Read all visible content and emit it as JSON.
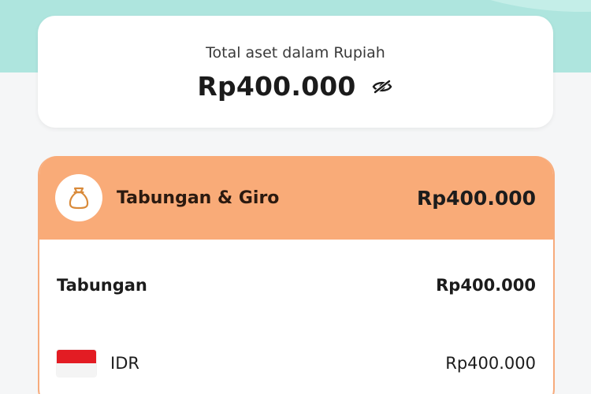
{
  "summary": {
    "label": "Total aset dalam Rupiah",
    "amount": "Rp400.000",
    "visibility_icon": "eye-slash-icon"
  },
  "group": {
    "icon": "money-bag-icon",
    "title": "Tabungan & Giro",
    "total": "Rp400.000"
  },
  "accounts": [
    {
      "label": "Tabungan",
      "amount": "Rp400.000"
    }
  ],
  "currencies": [
    {
      "flag": "indonesia-flag-icon",
      "code": "IDR",
      "amount": "Rp400.000"
    }
  ],
  "colors": {
    "header_bg": "#aee5de",
    "group_header": "#f9ab78",
    "accent_icon": "#d98a3a"
  }
}
